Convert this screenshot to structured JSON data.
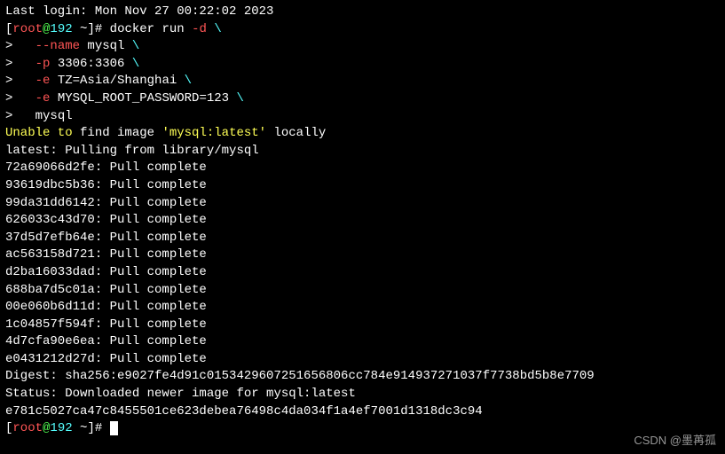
{
  "lastLogin": "Last login: Mon Nov 27 00:22:02 2023",
  "prompt": {
    "user": "root",
    "at": "@",
    "host": "192",
    "path": " ~",
    "hash": "]# "
  },
  "promptLeft": "[",
  "cmd": {
    "docker": "docker run ",
    "dashD": "-d",
    "space": " ",
    "bsl": "\\",
    "cont": ">   ",
    "name": "--name",
    "nameVal": " mysql ",
    "p": "-p",
    "pVal": " 3306:3306 ",
    "e1": "-e",
    "e1Val": " TZ=Asia/Shanghai ",
    "e2": "-e",
    "e2Val": " MYSQL_ROOT_PASSWORD=123 ",
    "last": "mysql"
  },
  "unable": {
    "p1": "Unable to",
    "p2": " find image ",
    "p3": "'mysql:latest'",
    "p4": " locally"
  },
  "pulling": "latest: Pulling from library/mysql",
  "layers": [
    "72a69066d2fe: Pull complete",
    "93619dbc5b36: Pull complete",
    "99da31dd6142: Pull complete",
    "626033c43d70: Pull complete",
    "37d5d7efb64e: Pull complete",
    "ac563158d721: Pull complete",
    "d2ba16033dad: Pull complete",
    "688ba7d5c01a: Pull complete",
    "00e060b6d11d: Pull complete",
    "1c04857f594f: Pull complete",
    "4d7cfa90e6ea: Pull complete",
    "e0431212d27d: Pull complete"
  ],
  "digest": "Digest: sha256:e9027fe4d91c0153429607251656806cc784e914937271037f7738bd5b8e7709",
  "status": "Status: Downloaded newer image for mysql:latest",
  "containerId": "e781c5027ca47c8455501ce623debea76498c4da034f1a4ef7001d1318dc3c94",
  "watermark": "CSDN @墨苒孤"
}
